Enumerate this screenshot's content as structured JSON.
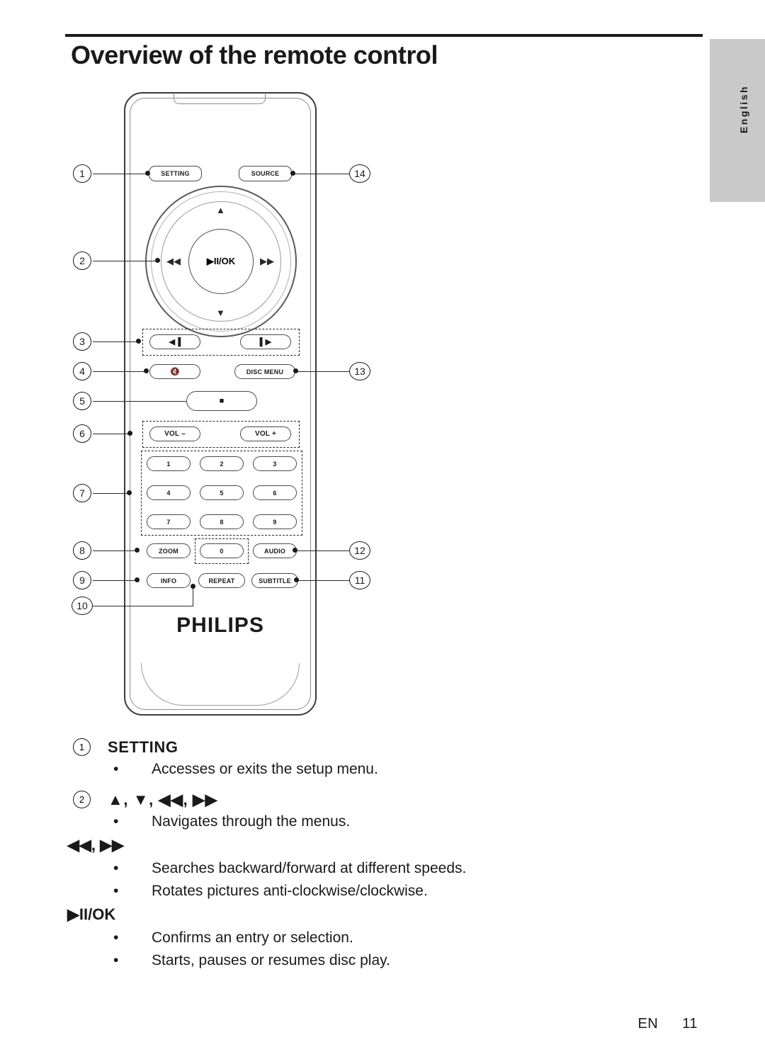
{
  "page": {
    "title": "Overview of the remote control",
    "side_tab_label": "English",
    "footer_lang": "EN",
    "footer_page": "11"
  },
  "remote": {
    "brand": "PHILIPS",
    "buttons": {
      "setting": "SETTING",
      "source": "SOURCE",
      "play_pause_ok": "▶II/OK",
      "arrow_up": "▲",
      "arrow_down": "▼",
      "rewind": "◀◀",
      "forward": "▶▶",
      "prev": "◀▐",
      "next": "▌▶",
      "mute": "🔇",
      "disc_menu": "DISC MENU",
      "stop": "■",
      "vol_minus": "VOL –",
      "vol_plus": "VOL +",
      "num1": "1",
      "num2": "2",
      "num3": "3",
      "num4": "4",
      "num5": "5",
      "num6": "6",
      "num7": "7",
      "num8": "8",
      "num9": "9",
      "num0": "0",
      "zoom": "ZOOM",
      "audio": "AUDIO",
      "info": "INFO",
      "repeat": "REPEAT",
      "subtitle": "SUBTITLE"
    },
    "callouts": {
      "c1": "1",
      "c2": "2",
      "c3": "3",
      "c4": "4",
      "c5": "5",
      "c6": "6",
      "c7": "7",
      "c8": "8",
      "c9": "9",
      "c10": "10",
      "c11": "11",
      "c12": "12",
      "c13": "13",
      "c14": "14"
    }
  },
  "descriptions": [
    {
      "num": "1",
      "heading": "SETTING",
      "bullets": [
        "Accesses or exits the setup menu."
      ]
    },
    {
      "num": "2",
      "heading": "▲, ▼, ◀◀, ▶▶",
      "bullets": [
        "Navigates through the menus."
      ],
      "subsections": [
        {
          "heading": "◀◀, ▶▶",
          "bullets": [
            "Searches backward/forward at different speeds.",
            "Rotates pictures anti-clockwise/clockwise."
          ]
        },
        {
          "heading": "▶II/OK",
          "bullets": [
            "Confirms an entry or selection.",
            "Starts, pauses or resumes disc play."
          ]
        }
      ]
    }
  ],
  "bullet_glyph": "•"
}
